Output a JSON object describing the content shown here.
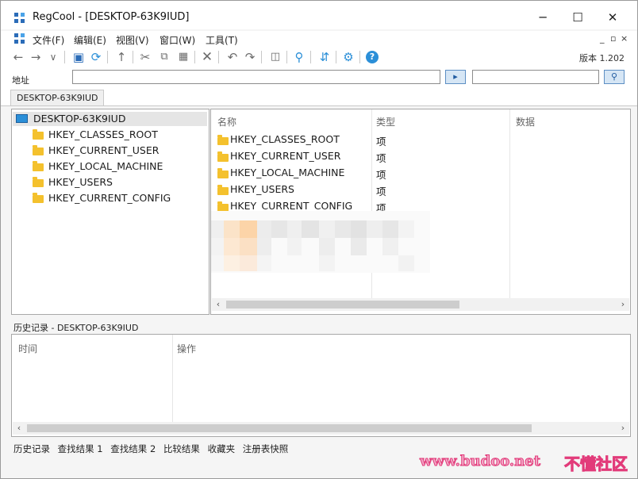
{
  "window": {
    "title": "RegCool - [DESKTOP-63K9IUD]",
    "controls": [
      "─",
      "☐",
      "✕"
    ]
  },
  "menu": {
    "items": [
      "文件(F)",
      "编辑(E)",
      "视图(V)",
      "窗口(W)",
      "工具(T)"
    ],
    "mdi": [
      "_",
      "▫",
      "×"
    ]
  },
  "toolbar": {
    "version": "版本 1.202",
    "icons": [
      "back-icon",
      "forward-icon",
      "dropdown-icon",
      "computer-icon",
      "refresh-icon",
      "up-icon",
      "cut-icon",
      "copy-icon",
      "paste-icon",
      "delete-icon",
      "undo-icon",
      "redo-icon",
      "new-key-icon",
      "search-icon",
      "compare-icon",
      "settings-icon",
      "help-icon"
    ]
  },
  "address": {
    "label": "地址",
    "value": "",
    "search_value": ""
  },
  "tabs": [
    "DESKTOP-63K9IUD"
  ],
  "tree": {
    "root": "DESKTOP-63K9IUD",
    "children": [
      "HKEY_CLASSES_ROOT",
      "HKEY_CURRENT_USER",
      "HKEY_LOCAL_MACHINE",
      "HKEY_USERS",
      "HKEY_CURRENT_CONFIG"
    ]
  },
  "list": {
    "columns": [
      "名称",
      "类型",
      "数据"
    ],
    "rows": [
      {
        "name": "HKEY_CLASSES_ROOT",
        "type": "项"
      },
      {
        "name": "HKEY_CURRENT_USER",
        "type": "项"
      },
      {
        "name": "HKEY_LOCAL_MACHINE",
        "type": "项"
      },
      {
        "name": "HKEY_USERS",
        "type": "项"
      },
      {
        "name": "HKEY_CURRENT_CONFIG",
        "type": "项"
      }
    ]
  },
  "history": {
    "label": "历史记录 - DESKTOP-63K9IUD",
    "columns": [
      "时间",
      "操作"
    ]
  },
  "status": {
    "tabs": [
      "历史记录",
      "查找结果 1",
      "查找结果 2",
      "比较结果",
      "收藏夹",
      "注册表快照"
    ]
  },
  "watermark": {
    "site": "www.budoo.net",
    "brand": "不懂社区"
  },
  "colors": {
    "accent": "#2b6cb8",
    "folder": "#f4c12d",
    "selection": "#e5e5e5",
    "watermark": "#e23b7a"
  }
}
